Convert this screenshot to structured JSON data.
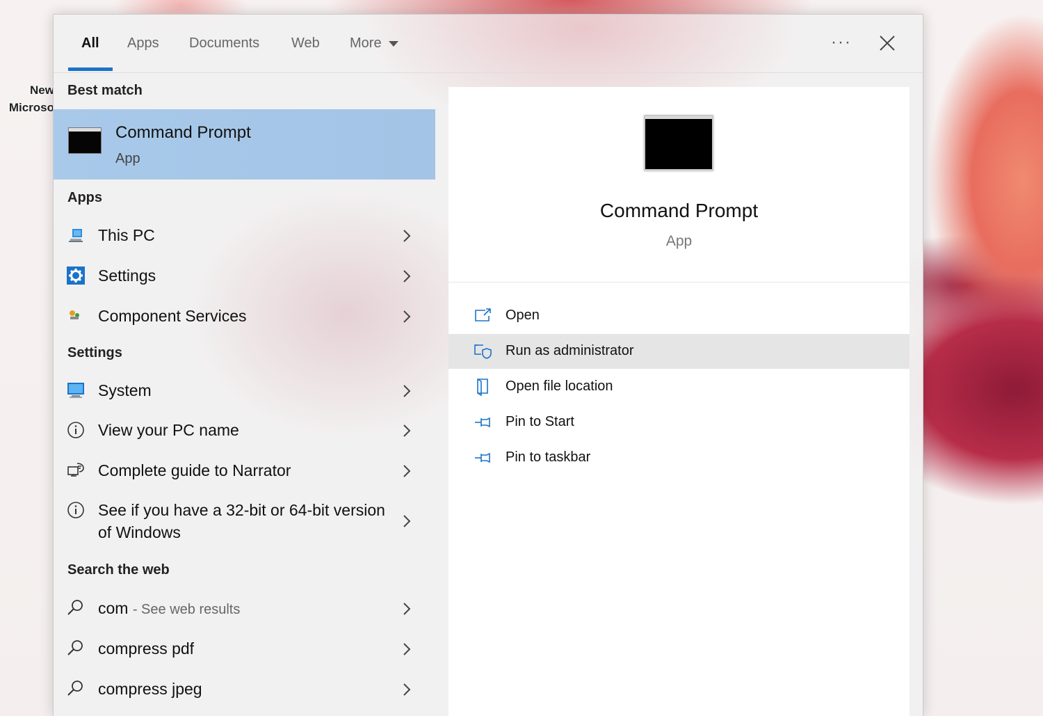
{
  "desktop": {
    "icon_label_line1": "New",
    "icon_label_line2": "Microso"
  },
  "tabs": [
    {
      "label": "All",
      "active": true
    },
    {
      "label": "Apps"
    },
    {
      "label": "Documents"
    },
    {
      "label": "Web"
    },
    {
      "label": "More"
    }
  ],
  "toolbar": {
    "more_options": "···"
  },
  "best_match": {
    "heading": "Best match",
    "title": "Command Prompt",
    "subtitle": "App"
  },
  "apps": {
    "heading": "Apps",
    "items": [
      {
        "label": "This PC",
        "icon": "this-pc-icon"
      },
      {
        "label": "Settings",
        "icon": "gear-icon"
      },
      {
        "label": "Component Services",
        "icon": "component-services-icon"
      }
    ]
  },
  "settings": {
    "heading": "Settings",
    "items": [
      {
        "label": "System",
        "icon": "monitor-icon"
      },
      {
        "label": "View your PC name",
        "icon": "info-icon"
      },
      {
        "label": "Complete guide to Narrator",
        "icon": "narrator-icon"
      },
      {
        "label": "See if you have a 32-bit or 64-bit version of Windows",
        "icon": "info-icon"
      }
    ]
  },
  "web": {
    "heading": "Search the web",
    "items": [
      {
        "label": "com",
        "suffix": "- See web results",
        "icon": "search-icon"
      },
      {
        "label": "compress pdf",
        "icon": "search-icon"
      },
      {
        "label": "compress jpeg",
        "icon": "search-icon"
      }
    ]
  },
  "detail": {
    "title": "Command Prompt",
    "subtitle": "App",
    "actions": [
      {
        "label": "Open",
        "icon": "open-icon"
      },
      {
        "label": "Run as administrator",
        "icon": "run-as-admin-icon",
        "highlighted": true
      },
      {
        "label": "Open file location",
        "icon": "file-location-icon"
      },
      {
        "label": "Pin to Start",
        "icon": "pin-icon"
      },
      {
        "label": "Pin to taskbar",
        "icon": "pin-icon"
      }
    ]
  },
  "colors": {
    "accent": "#1a73c8",
    "selected_row": "#a8c9ea",
    "hover_row": "#e5e5e5",
    "icon_blue": "#1a73c8"
  }
}
